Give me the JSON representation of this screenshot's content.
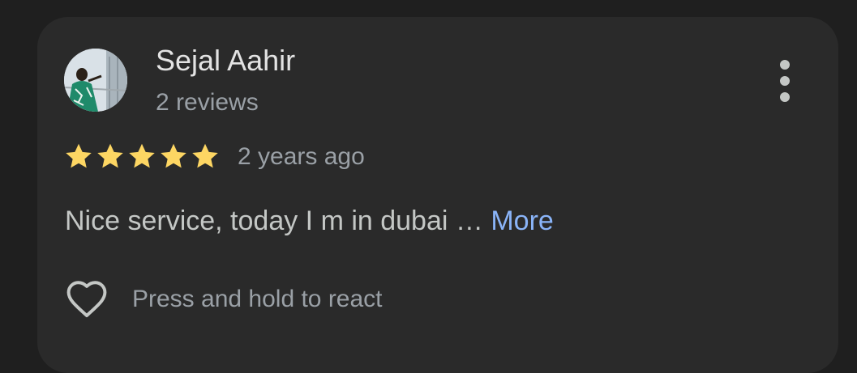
{
  "review": {
    "author": {
      "name": "Sejal Aahir",
      "reviews_count": "2 reviews",
      "avatar_icon": "profile-photo"
    },
    "rating": {
      "stars": 5,
      "max": 5,
      "star_color": "#fdd663"
    },
    "time_ago": "2 years ago",
    "text": "Nice service, today I m in dubai …",
    "more_label": "More",
    "menu_icon": "more-vertical-icon",
    "react": {
      "icon": "heart-outline-icon",
      "label": "Press and hold to react"
    }
  },
  "colors": {
    "background": "#1f1f1f",
    "card": "#2a2a2a",
    "primary_text": "#e3e3e3",
    "secondary_text": "#9aa0a6",
    "link": "#8ab4f8"
  }
}
